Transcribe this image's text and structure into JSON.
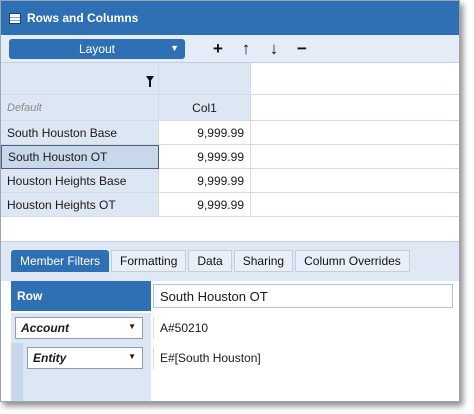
{
  "window": {
    "title": "Rows and Columns"
  },
  "toolbar": {
    "layout_label": "Layout",
    "buttons": [
      {
        "icon": "+",
        "name": "add"
      },
      {
        "icon": "↑",
        "name": "move-up"
      },
      {
        "icon": "↓",
        "name": "move-down"
      },
      {
        "icon": "−",
        "name": "remove"
      }
    ]
  },
  "grid": {
    "default_label": "Default",
    "column_header": "Col1",
    "rows": [
      {
        "label": "South Houston Base",
        "value": "9,999.99"
      },
      {
        "label": "South Houston OT",
        "value": "9,999.99"
      },
      {
        "label": "Houston Heights Base",
        "value": "9,999.99"
      },
      {
        "label": "Houston Heights OT",
        "value": "9,999.99"
      }
    ]
  },
  "tabs": [
    {
      "label": "Member Filters",
      "active": true
    },
    {
      "label": "Formatting",
      "active": false
    },
    {
      "label": "Data",
      "active": false
    },
    {
      "label": "Sharing",
      "active": false
    },
    {
      "label": "Column Overrides",
      "active": false
    }
  ],
  "form": {
    "row_label": "Row",
    "row_value": "South Houston OT",
    "account": {
      "dimension": "Account",
      "value": "A#50210"
    },
    "entity": {
      "dimension": "Entity",
      "value": "E#[South Houston]"
    }
  },
  "colors": {
    "accent": "#2f6fb3",
    "header_bg": "#dde6f3",
    "toolbar_bg": "#e4ecf7"
  }
}
